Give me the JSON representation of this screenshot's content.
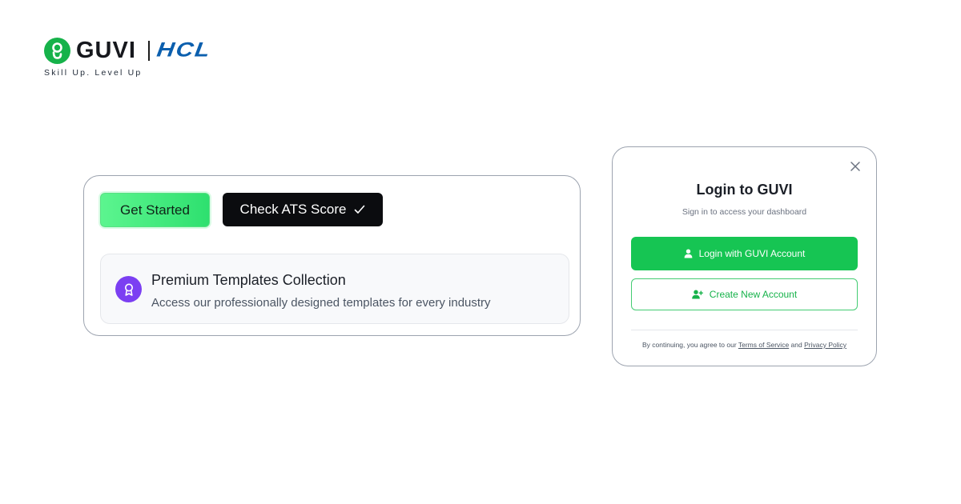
{
  "brand": {
    "guvi_name": "GUVI",
    "partner_name": "HCL",
    "tagline": "Skill Up. Level Up",
    "guvi_color": "#16b24a",
    "hcl_color": "#0b5fae"
  },
  "hero_card": {
    "get_started_label": "Get Started",
    "ats_label": "Check ATS Score",
    "ats_icon": "check-icon",
    "premium": {
      "icon": "award-icon",
      "title": "Premium Templates Collection",
      "description": "Access our professionally designed templates for every industry"
    }
  },
  "login_dialog": {
    "close_icon": "close-icon",
    "title": "Login to GUVI",
    "subtitle": "Sign in to access your dashboard",
    "login_button_label": "Login with GUVI Account",
    "create_button_label": "Create New Account",
    "terms_prefix": "By continuing, you agree to our",
    "terms_link": "Terms of Service",
    "terms_and": "and",
    "privacy_link": "Privacy Policy",
    "accent_color": "#16c553"
  }
}
